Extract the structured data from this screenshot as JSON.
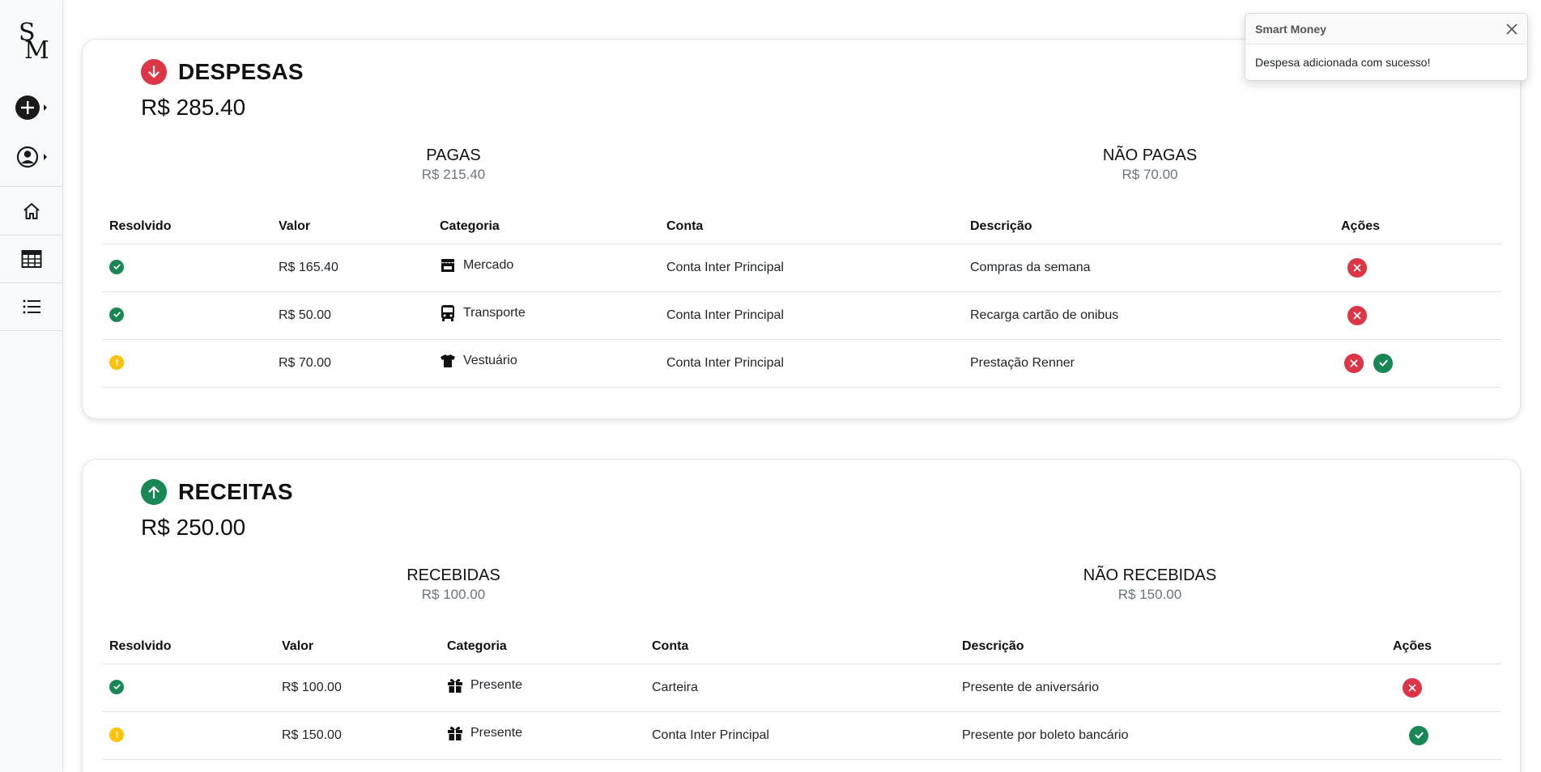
{
  "app": {
    "name": "Smart Money",
    "logo_top": "S",
    "logo_bottom": "M"
  },
  "sidebar": {
    "items": [
      {
        "icon": "plus-circle-icon"
      },
      {
        "icon": "user-circle-icon"
      },
      {
        "icon": "home-icon"
      },
      {
        "icon": "table-icon"
      },
      {
        "icon": "list-icon"
      }
    ]
  },
  "toast": {
    "title": "Smart Money",
    "message": "Despesa adicionada com sucesso!"
  },
  "colors": {
    "danger": "#dc3545",
    "success": "#198754",
    "warning": "#ffc107"
  },
  "despesas": {
    "title": "DESPESAS",
    "total": "R$ 285.40",
    "paid_label": "PAGAS",
    "paid_value": "R$ 215.40",
    "unpaid_label": "NÃO PAGAS",
    "unpaid_value": "R$ 70.00",
    "columns": [
      "Resolvido",
      "Valor",
      "Categoria",
      "Conta",
      "Descrição",
      "Ações"
    ],
    "rows": [
      {
        "status": "ok",
        "valor": "R$ 165.40",
        "categoria": "Mercado",
        "cat_icon": "store-icon",
        "conta": "Conta Inter Principal",
        "descricao": "Compras da semana",
        "actions": [
          "delete"
        ]
      },
      {
        "status": "ok",
        "valor": "R$ 50.00",
        "categoria": "Transporte",
        "cat_icon": "bus-icon",
        "conta": "Conta Inter Principal",
        "descricao": "Recarga cartão de onibus",
        "actions": [
          "delete"
        ]
      },
      {
        "status": "pending",
        "valor": "R$ 70.00",
        "categoria": "Vestuário",
        "cat_icon": "shirt-icon",
        "conta": "Conta Inter Principal",
        "descricao": "Prestação Renner",
        "actions": [
          "delete",
          "confirm"
        ]
      }
    ]
  },
  "receitas": {
    "title": "RECEITAS",
    "total": "R$ 250.00",
    "received_label": "RECEBIDAS",
    "received_value": "R$ 100.00",
    "unreceived_label": "NÃO RECEBIDAS",
    "unreceived_value": "R$ 150.00",
    "columns": [
      "Resolvido",
      "Valor",
      "Categoria",
      "Conta",
      "Descrição",
      "Ações"
    ],
    "rows": [
      {
        "status": "ok",
        "valor": "R$ 100.00",
        "categoria": "Presente",
        "cat_icon": "gift-icon",
        "conta": "Carteira",
        "descricao": "Presente de aniversário",
        "actions": [
          "delete"
        ]
      },
      {
        "status": "pending",
        "valor": "R$ 150.00",
        "categoria": "Presente",
        "cat_icon": "gift-icon",
        "conta": "Conta Inter Principal",
        "descricao": "Presente por boleto bancário",
        "actions": [
          "confirm"
        ]
      }
    ]
  }
}
